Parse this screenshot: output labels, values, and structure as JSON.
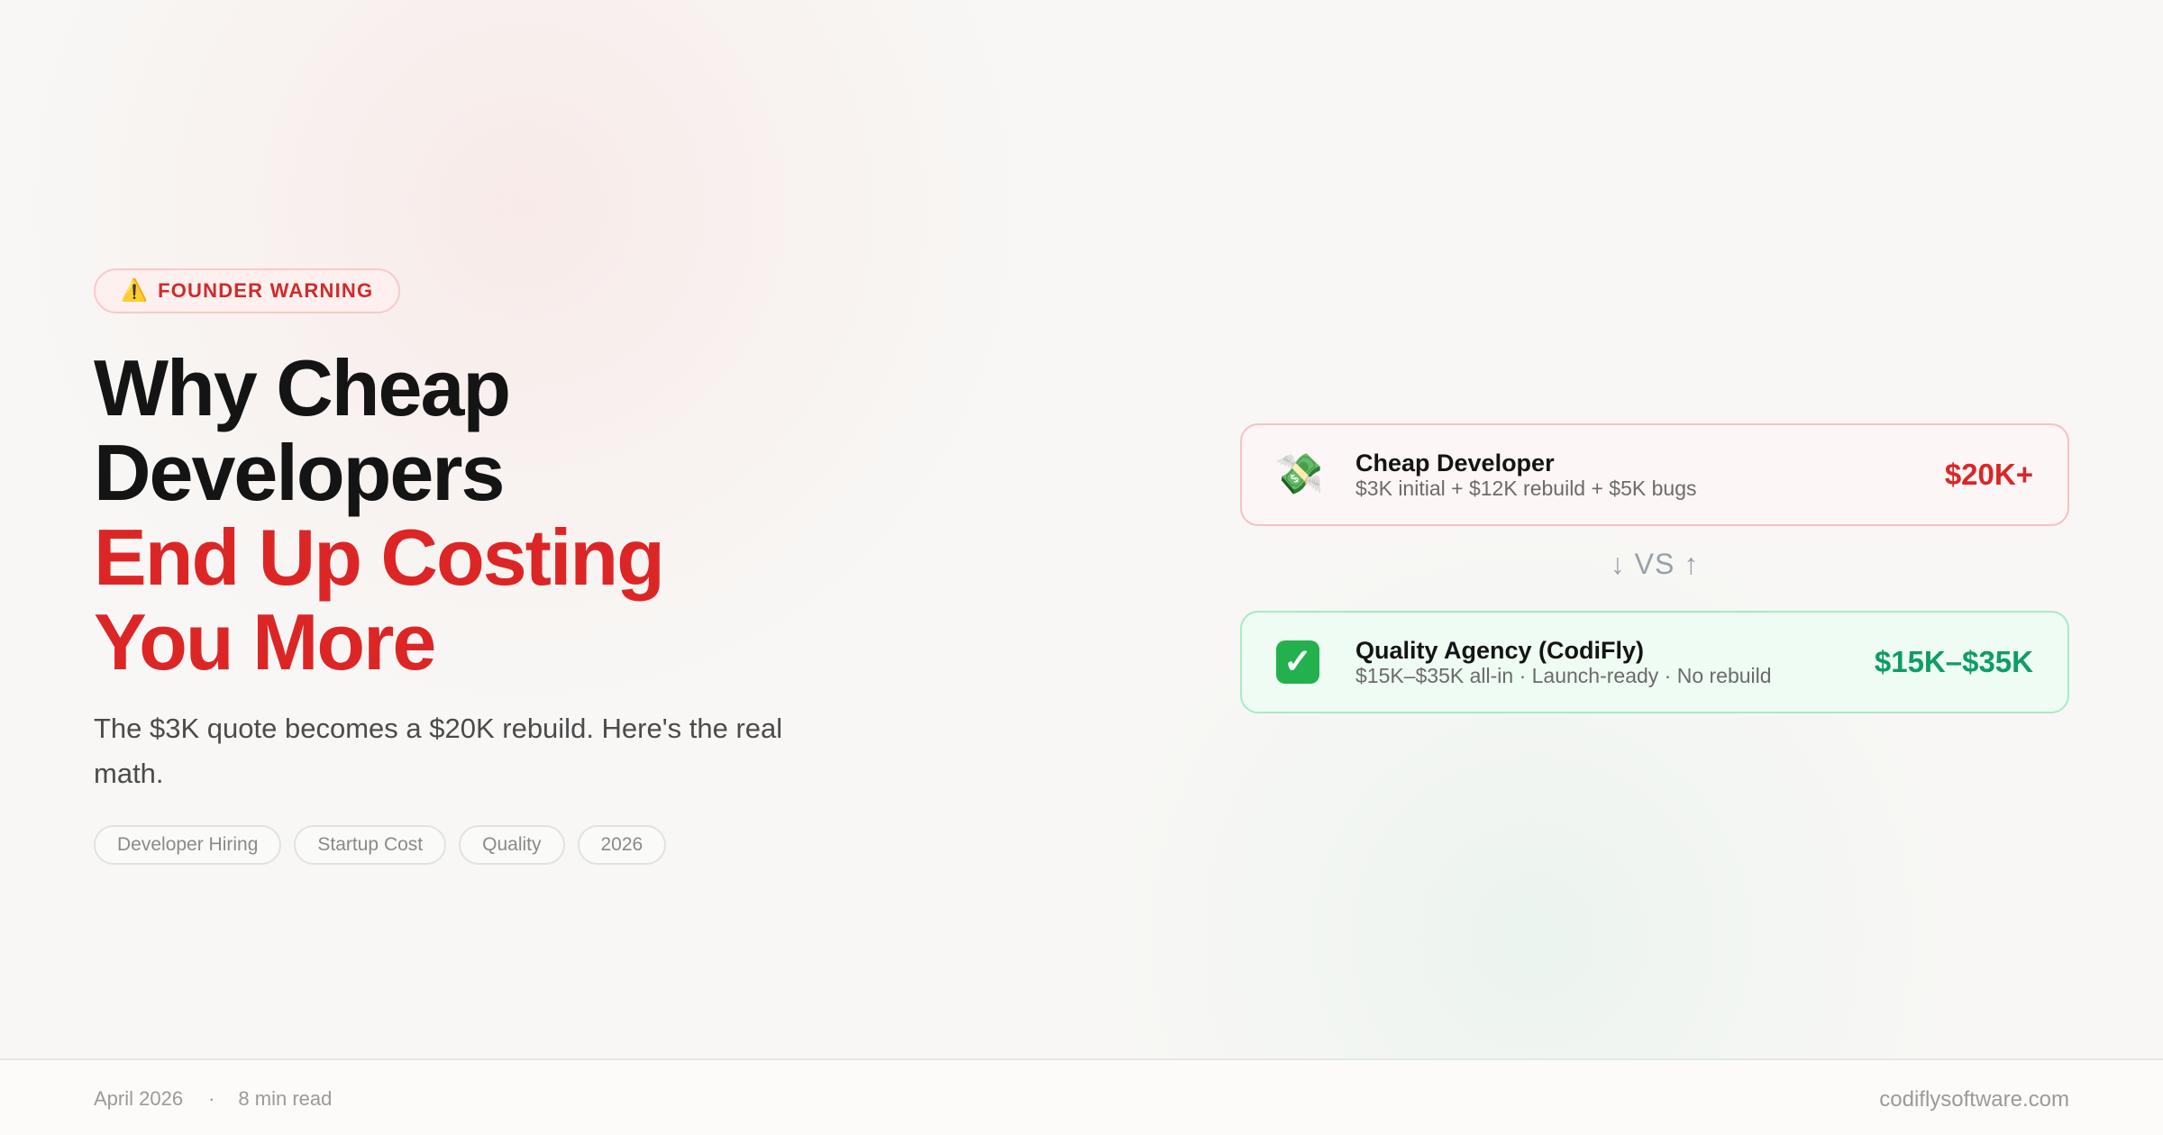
{
  "badge": {
    "icon": "warning-icon",
    "label": "FOUNDER WARNING"
  },
  "headline": {
    "line1": "Why Cheap",
    "line2": "Developers",
    "line3": "End Up Costing",
    "line4": "You More"
  },
  "subtitle": "The $3K quote becomes a $20K rebuild. Here's the real math.",
  "tags": [
    "Developer Hiring",
    "Startup Cost",
    "Quality",
    "2026"
  ],
  "comparison": {
    "cheap": {
      "icon": "money-with-wings-icon",
      "title": "Cheap Developer",
      "description": "$3K initial + $12K rebuild + $5K bugs",
      "price": "$20K+"
    },
    "vs_label": "↓ VS ↑",
    "quality": {
      "icon": "check-mark-icon",
      "title": "Quality Agency (CodiFly)",
      "description": "$15K–$35K all-in · Launch-ready · No rebuild",
      "price": "$15K–$35K"
    }
  },
  "footer": {
    "date": "April 2026",
    "separator": "·",
    "read_time": "8 min read",
    "domain": "codiflysoftware.com"
  },
  "colors": {
    "accent_red": "#dc2626",
    "accent_green": "#0f9d63",
    "text_dark": "#141414"
  }
}
